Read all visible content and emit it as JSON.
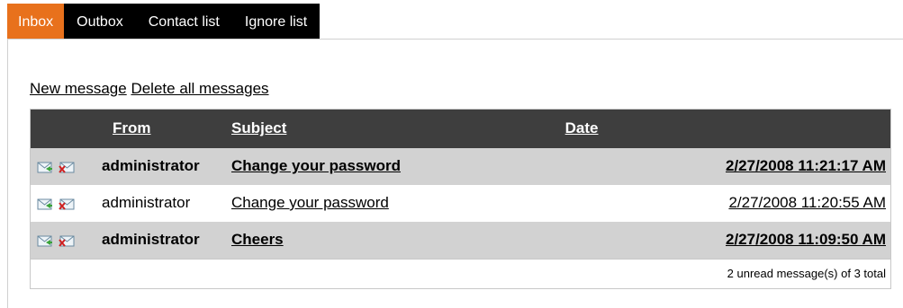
{
  "tabs": [
    {
      "label": "Inbox",
      "active": true
    },
    {
      "label": "Outbox",
      "active": false
    },
    {
      "label": "Contact list",
      "active": false
    },
    {
      "label": "Ignore list",
      "active": false
    }
  ],
  "actions": {
    "new_message": "New message",
    "delete_all": "Delete all messages"
  },
  "table": {
    "headers": {
      "from": "From",
      "subject": "Subject",
      "date": "Date"
    },
    "rows": [
      {
        "from": "administrator",
        "subject": "Change your password",
        "date": "2/27/2008 11:21:17 AM",
        "unread": true
      },
      {
        "from": "administrator",
        "subject": "Change your password",
        "date": "2/27/2008 11:20:55 AM",
        "unread": false
      },
      {
        "from": "administrator",
        "subject": "Cheers",
        "date": "2/27/2008 11:09:50 AM",
        "unread": true
      }
    ],
    "footer": "2 unread message(s) of 3 total"
  },
  "icons": {
    "reply": "reply-envelope-icon",
    "delete": "delete-envelope-icon"
  },
  "colors": {
    "active_tab": "#e8711c",
    "tab_bar": "#000000",
    "header_row": "#3e3e3e",
    "unread_row": "#d2d2d2"
  }
}
